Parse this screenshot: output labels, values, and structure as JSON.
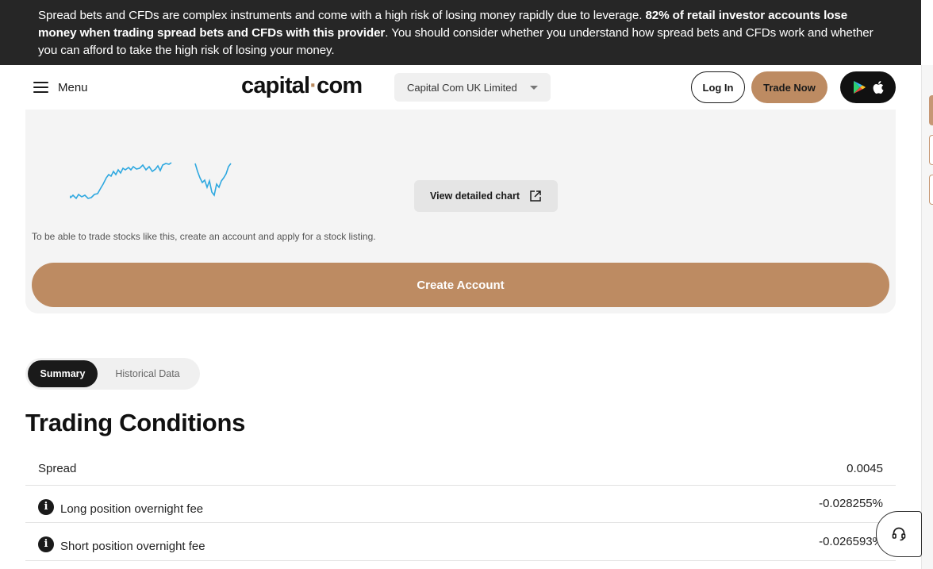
{
  "risk_banner": {
    "text_start": "Spread bets and CFDs are complex instruments and come with a high risk of losing money rapidly due to leverage. ",
    "text_bold": "82% of retail investor accounts lose money when trading spread bets and CFDs with this provider",
    "text_end": ". You should consider whether you understand how spread bets and CFDs work and whether you can afford to take the high risk of losing your money."
  },
  "header": {
    "menu_label": "Menu",
    "logo_left": "capital",
    "logo_dot": "·",
    "logo_right": "com",
    "entity_select_value": "Capital Com UK Limited",
    "login_label": "Log In",
    "trade_label": "Trade Now"
  },
  "chart_card": {
    "detail_button_label": "View detailed chart",
    "note": "To be able to trade stocks like this, create an account and apply for a stock listing.",
    "create_account_label": "Create Account"
  },
  "tabs": [
    {
      "label": "Summary",
      "active": true
    },
    {
      "label": "Historical Data",
      "active": false
    }
  ],
  "trading_conditions": {
    "title": "Trading Conditions",
    "rows": [
      {
        "label": "Spread",
        "value": "0.0045",
        "info": false
      },
      {
        "label": "Long position overnight fee",
        "value": "-0.028255%",
        "info": true
      },
      {
        "label": "Short position overnight fee",
        "value": "-0.026593%",
        "info": true
      }
    ]
  },
  "colors": {
    "brand_accent": "#bd8b62",
    "banner_bg": "#262626",
    "chart_line": "#2ea8e0"
  },
  "icons": [
    "hamburger-icon",
    "caret-down-icon",
    "google-play-icon",
    "apple-icon",
    "expand-icon",
    "info-icon",
    "headset-icon"
  ]
}
